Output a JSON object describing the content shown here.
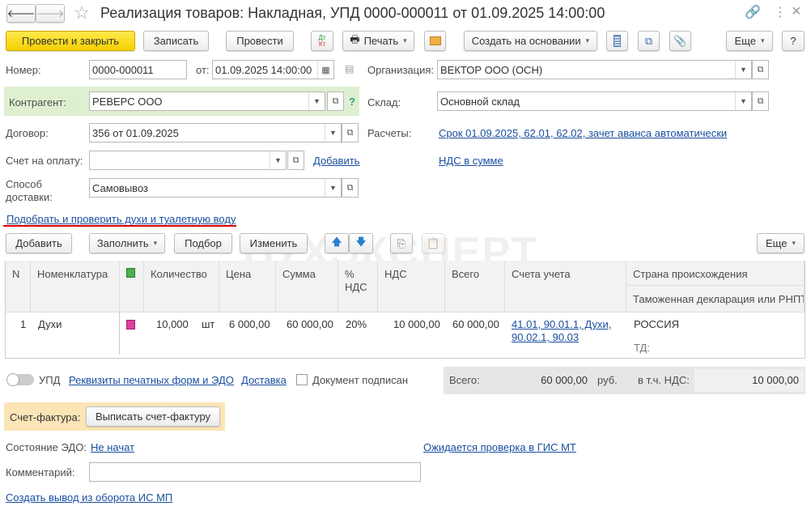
{
  "title": "Реализация товаров: Накладная, УПД 0000-000011 от 01.09.2025 14:00:00",
  "toolbar": {
    "post_close": "Провести и закрыть",
    "save": "Записать",
    "post": "Провести",
    "dtkt_top": "Дт",
    "dtkt_bottom": "Кт",
    "print": "Печать",
    "create_based": "Создать на основании",
    "more": "Еще",
    "help": "?"
  },
  "form": {
    "number_label": "Номер:",
    "number": "0000-000011",
    "date_label": "от:",
    "date": "01.09.2025 14:00:00",
    "org_label": "Организация:",
    "org": "ВЕКТОР ООО (ОСН)",
    "counterparty_label": "Контрагент:",
    "counterparty": "РЕВЕРС ООО",
    "help_mark": "?",
    "warehouse_label": "Склад:",
    "warehouse": "Основной склад",
    "contract_label": "Договор:",
    "contract": "356 от 01.09.2025",
    "settlements_label": "Расчеты:",
    "settlements_link": "Срок 01.09.2025, 62.01, 62.02, зачет аванса автоматически",
    "invoice_label": "Счет на оплату:",
    "invoice": "",
    "add_link": "Добавить",
    "vat_link": "НДС в сумме",
    "delivery_label_1": "Способ",
    "delivery_label_2": "доставки:",
    "delivery": "Самовывоз",
    "pick_link": "Подобрать и проверить духи и туалетную воду"
  },
  "table_toolbar": {
    "add": "Добавить",
    "fill": "Заполнить",
    "pick": "Подбор",
    "edit": "Изменить",
    "more": "Еще"
  },
  "watermark": "БУХЭКСПЕРТ",
  "table": {
    "headers": {
      "n": "N",
      "item": "Номенклатура",
      "qty": "Количество",
      "price": "Цена",
      "sum": "Сумма",
      "vat_rate_1": "%",
      "vat_rate_2": "НДС",
      "vat": "НДС",
      "total": "Всего",
      "accounts": "Счета учета",
      "country": "Страна происхождения",
      "customs": "Таможенная декларация или РНПТ"
    },
    "rows": [
      {
        "n": "1",
        "item": "Духи",
        "qty": "10,000",
        "unit": "шт",
        "price": "6 000,00",
        "sum": "60 000,00",
        "vat_rate": "20%",
        "vat": "10 000,00",
        "total": "60 000,00",
        "accounts_1": "41.01, 90.01.1, Духи,",
        "accounts_2": "90.02.1, 90.03",
        "country": "РОССИЯ",
        "customs": "ТД:"
      }
    ]
  },
  "footer": {
    "upd": "УПД",
    "print_forms_link": "Реквизиты печатных форм и ЭДО",
    "delivery_link": "Доставка",
    "signed": "Документ подписан",
    "total_label": "Всего:",
    "total": "60 000,00",
    "currency": "руб.",
    "vat_label": "в т.ч. НДС:",
    "vat": "10 000,00",
    "sf_label": "Счет-фактура:",
    "sf_button": "Выписать счет-фактуру",
    "edo_label": "Состояние ЭДО:",
    "edo_link": "Не начат",
    "gis_link": "Ожидается проверка в ГИС МТ",
    "comment_label": "Комментарий:",
    "comment": "",
    "ismp_link": "Создать вывод из оборота ИС МП"
  }
}
